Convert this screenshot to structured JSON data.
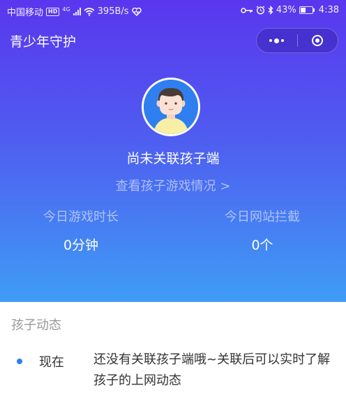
{
  "status_bar": {
    "carrier": "中国移动",
    "hd": "HD",
    "network": "4G",
    "speed": "395B/s",
    "battery": "43%",
    "battery_level": 0.43,
    "time": "4:38"
  },
  "header": {
    "title": "青少年守护"
  },
  "profile": {
    "name": "尚未关联孩子端",
    "view_link": "查看孩子游戏情况 >"
  },
  "stats": {
    "game_time_label": "今日游戏时长",
    "game_time_value": "0分钟",
    "blocked_label": "今日网站拦截",
    "blocked_value": "0个"
  },
  "activity": {
    "section_title": "孩子动态",
    "items": [
      {
        "time": "现在",
        "text": "还没有关联孩子端哦~关联后可以实时了解孩子的上网动态"
      }
    ]
  },
  "colors": {
    "gradient_top": "#5a36ee",
    "gradient_bottom": "#3f9cf5",
    "accent": "#2f7ff0"
  }
}
